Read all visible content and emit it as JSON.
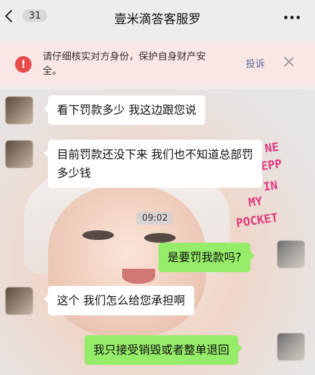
{
  "header": {
    "back_label": "返回",
    "unread_count": "31",
    "title": "壹米滴答客服罗"
  },
  "banner": {
    "warning_text": "请仔细核实对方身份，保护自身财产安全。",
    "report_label": "投诉"
  },
  "wallpaper_text": [
    "NE",
    "KEPP",
    "IN",
    "MY",
    "POCKET"
  ],
  "timestamp": "09:02",
  "messages": [
    {
      "side": "left",
      "text": "看下罚款多少  我这边跟您说"
    },
    {
      "side": "left",
      "text": "目前罚款还没下来 我们也不知道总部罚多少钱"
    },
    {
      "side": "right",
      "text": "是要罚我款吗?"
    },
    {
      "side": "left",
      "text": "这个  我们怎么给您承担啊"
    },
    {
      "side": "right",
      "text": "我只接受销毁或者整单退回"
    }
  ],
  "colors": {
    "outgoing_bubble": "#95ec69",
    "incoming_bubble": "#ffffff",
    "warning_red": "#e84949",
    "link_blue": "#576b95"
  }
}
